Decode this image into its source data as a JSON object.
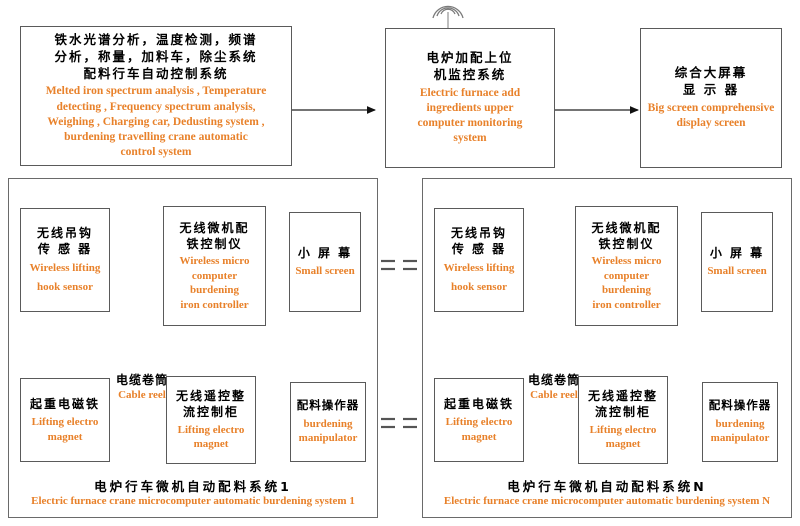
{
  "diagram": {
    "accent_color": "#E8812A",
    "text_color": "#000000",
    "border_color": "#5a5a5a"
  },
  "top_row": {
    "analysis_box": {
      "cn": "铁水光谱分析，温度检测，频谱分析，称量，加料车，除尘系统配料行车自动控制系统",
      "cn_line1": "铁水光谱分析，温度检测，频谱",
      "cn_line2": "分析，称量，加料车，除尘系统",
      "cn_line3": "配料行车自动控制系统",
      "en_line1": "Melted iron spectrum analysis , Temperature",
      "en_line2": "detecting , Frequency spectrum analysis,",
      "en_line3": "Weighing , Charging car, Dedusting system ,",
      "en_line4": "burdening travelling crane automatic",
      "en_line5": "control system"
    },
    "monitoring_box": {
      "cn_line1": "电炉加配上位",
      "cn_line2": "机监控系统",
      "en_line1": "Electric furnace add",
      "en_line2": "ingredients upper",
      "en_line3": "computer monitoring",
      "en_line4": "system"
    },
    "display_box": {
      "cn_line1": "综合大屏幕",
      "cn_line2": "显 示 器",
      "en_line1": "Big screen comprehensive",
      "en_line2": "display screen"
    }
  },
  "system_1": {
    "caption_cn": "电炉行车微机自动配料系统1",
    "caption_en": "Electric furnace crane microcomputer automatic burdening system 1",
    "hook_sensor": {
      "cn_line1": "无线吊钩",
      "cn_line2": "传 感 器",
      "en_line1": "Wireless lifting",
      "en_line2": "hook sensor"
    },
    "controller": {
      "cn_line1": "无线微机配",
      "cn_line2": "铁控制仪",
      "en_line1": "Wireless micro",
      "en_line2": "computer",
      "en_line3": "burdening",
      "en_line4": "iron controller"
    },
    "small_screen": {
      "cn_line1": "小 屏 幕",
      "en_line1": "Small screen"
    },
    "electro_magnet": {
      "cn_line1": "起重电磁铁",
      "en_line1": "Lifting electro",
      "en_line2": "magnet"
    },
    "rectifier_cabinet": {
      "cn_line1": "无线遥控整",
      "cn_line2": "流控制柜",
      "en_line1": "Lifting electro",
      "en_line2": "magnet"
    },
    "manipulator": {
      "cn_line1": "配料操作器",
      "en_line1": "burdening",
      "en_line2": "manipulator"
    },
    "cable_reel": {
      "cn_line1": "电缆卷筒",
      "en_line1": "Cable  reel"
    }
  },
  "system_n": {
    "caption_cn": "电炉行车微机自动配料系统N",
    "caption_en": "Electric furnace crane microcomputer automatic burdening system N",
    "hook_sensor": {
      "cn_line1": "无线吊钩",
      "cn_line2": "传 感 器",
      "en_line1": "Wireless lifting",
      "en_line2": "hook sensor"
    },
    "controller": {
      "cn_line1": "无线微机配",
      "cn_line2": "铁控制仪",
      "en_line1": "Wireless micro",
      "en_line2": "computer",
      "en_line3": "burdening",
      "en_line4": "iron controller"
    },
    "small_screen": {
      "cn_line1": "小 屏 幕",
      "en_line1": "Small screen"
    },
    "electro_magnet": {
      "cn_line1": "起重电磁铁",
      "en_line1": "Lifting electro",
      "en_line2": "magnet"
    },
    "rectifier_cabinet": {
      "cn_line1": "无线遥控整",
      "cn_line2": "流控制柜",
      "en_line1": "Lifting electro",
      "en_line2": "magnet"
    },
    "manipulator": {
      "cn_line1": "配料操作器",
      "en_line1": "burdening",
      "en_line2": "manipulator"
    },
    "cable_reel": {
      "cn_line1": "电缆卷筒",
      "en_line1": "Cable  reel"
    }
  },
  "icons": {
    "antenna": "antenna-icon",
    "cable_reel_symbol": "cable-reel-symbol-icon",
    "ellipsis_separator": "equals-separator-icon"
  }
}
